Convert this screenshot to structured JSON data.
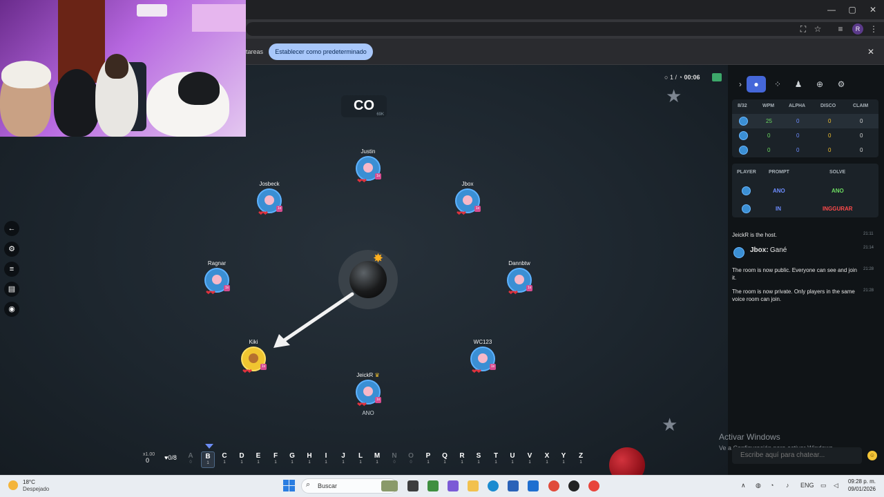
{
  "browser": {
    "infobar_partial": "tareas",
    "default_button": "Establecer como predeterminado",
    "profile_initial": "R"
  },
  "game": {
    "syllable": "CO",
    "syllable_count": "69K",
    "round": "1 /",
    "timer": "00:06",
    "players": [
      {
        "name": "Justin",
        "word": ""
      },
      {
        "name": "Josbeck",
        "word": ""
      },
      {
        "name": "Jbox",
        "word": ""
      },
      {
        "name": "Ragnar",
        "word": ""
      },
      {
        "name": "Dannbtw",
        "word": ""
      },
      {
        "name": "Kiki",
        "word": ""
      },
      {
        "name": "WC123",
        "word": ""
      },
      {
        "name": "JeickR",
        "word": "ANO"
      }
    ],
    "multiplier": "1x",
    "lives_label": "x1.00",
    "lives_value": "0",
    "hearts_counter": "♥0/8",
    "letters": [
      {
        "char": "A",
        "num": "0"
      },
      {
        "char": "B",
        "num": "1"
      },
      {
        "char": "C",
        "num": "1"
      },
      {
        "char": "D",
        "num": "1"
      },
      {
        "char": "E",
        "num": "1"
      },
      {
        "char": "F",
        "num": "1"
      },
      {
        "char": "G",
        "num": "1"
      },
      {
        "char": "H",
        "num": "1"
      },
      {
        "char": "I",
        "num": "1"
      },
      {
        "char": "J",
        "num": "1"
      },
      {
        "char": "L",
        "num": "1"
      },
      {
        "char": "M",
        "num": "1"
      },
      {
        "char": "N",
        "num": "0"
      },
      {
        "char": "O",
        "num": "0"
      },
      {
        "char": "P",
        "num": "1"
      },
      {
        "char": "Q",
        "num": "1"
      },
      {
        "char": "R",
        "num": "1"
      },
      {
        "char": "S",
        "num": "1"
      },
      {
        "char": "T",
        "num": "1"
      },
      {
        "char": "U",
        "num": "1"
      },
      {
        "char": "V",
        "num": "1"
      },
      {
        "char": "X",
        "num": "1"
      },
      {
        "char": "Y",
        "num": "1"
      },
      {
        "char": "Z",
        "num": "1"
      }
    ]
  },
  "stats": {
    "headers": [
      "8/32",
      "WPM",
      "ALPHA",
      "DISCO",
      "CLAIM"
    ],
    "rows": [
      [
        "25",
        "0",
        "0",
        "0"
      ],
      [
        "0",
        "0",
        "0",
        "0"
      ],
      [
        "0",
        "0",
        "0",
        "0"
      ]
    ]
  },
  "solves": {
    "headers": [
      "PLAYER",
      "PROMPT",
      "SOLVE"
    ],
    "rows": [
      {
        "prompt": "ANO",
        "solve": "ANO"
      },
      {
        "prompt": "IN",
        "solve": "INGGURAR"
      }
    ]
  },
  "chat": {
    "messages": [
      {
        "text": "JeickR is the host.",
        "time": "21:11"
      },
      {
        "author": "Jbox:",
        "text": "Gané",
        "time": "21:14"
      },
      {
        "text": "The room is now public. Everyone can see and join it.",
        "time": "21:28"
      },
      {
        "text": "The room is now private. Only players in the same voice room can join.",
        "time": "21:28"
      }
    ],
    "placeholder": "Escribe aquí para chatear..."
  },
  "windows": {
    "activate_title": "Activar Windows",
    "activate_sub": "Ve a Configuración para activar Windows.",
    "temp": "18°C",
    "weather": "Despejado",
    "search": "Buscar",
    "lang": "ENG",
    "time": "09:28 p. m.",
    "date": "09/01/2026"
  },
  "colors": {
    "accent": "#4567d9",
    "wpm": "#6ddc61",
    "alpha": "#6d8dff",
    "disco": "#f0c030",
    "fail": "#ff4a4a"
  }
}
